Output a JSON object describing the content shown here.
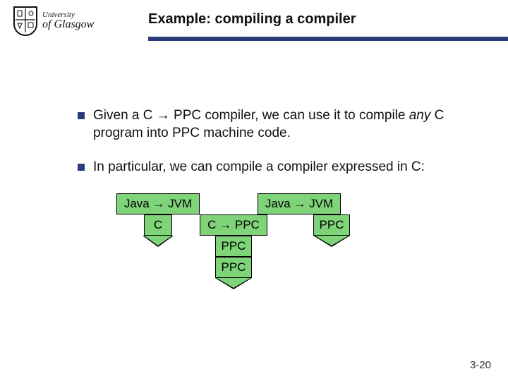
{
  "logo": {
    "line1": "University",
    "line2": "of Glasgow"
  },
  "title": "Example: compiling a compiler",
  "bullets": [
    {
      "pre": "Given a C → PPC compiler, we can use it to compile ",
      "em": "any",
      "post": " C program into PPC machine code."
    },
    {
      "pre": "In particular, we can compile a compiler expressed in C:",
      "em": "",
      "post": ""
    }
  ],
  "diagram": {
    "top_left": "Java → JVM",
    "stem_left": "C",
    "top_right": "Java → JVM",
    "stem_right": "PPC",
    "mid": "C → PPC",
    "mid_below": "PPC",
    "bottom": "PPC"
  },
  "page_number": "3-20"
}
